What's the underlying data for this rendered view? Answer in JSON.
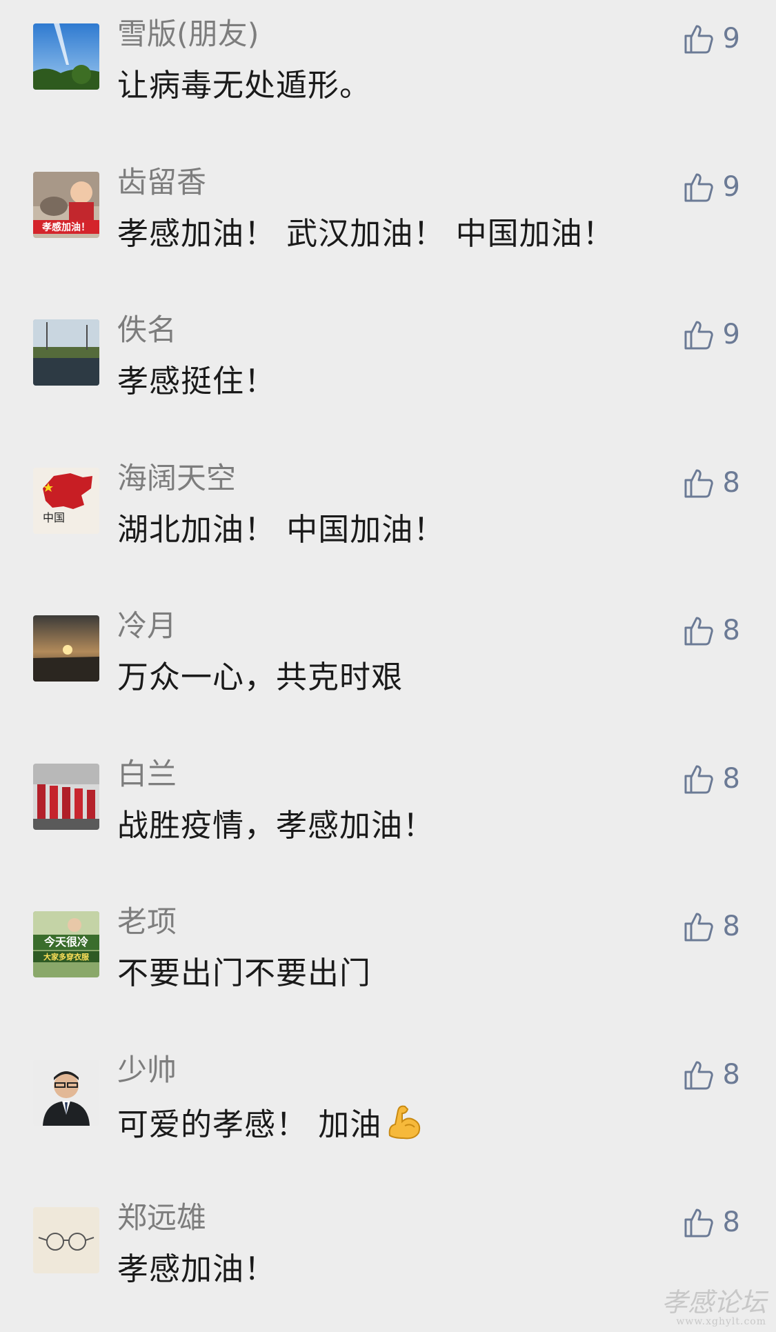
{
  "colors": {
    "background": "#ededed",
    "name": "#7d7d7d",
    "text": "#1a1a1a",
    "like": "#6b7a95"
  },
  "like_icon": "thumbs-up-icon",
  "comments": [
    {
      "name": "雪版(朋友)",
      "text": "让病毒无处遁形。",
      "likes": "9"
    },
    {
      "name": "齿留香",
      "text": "孝感加油！ 武汉加油！ 中国加油！",
      "likes": "9",
      "avatar_text": "孝感加油！"
    },
    {
      "name": "佚名",
      "text": "孝感挺住！",
      "likes": "9"
    },
    {
      "name": "海阔天空",
      "text": "湖北加油！ 中国加油！",
      "likes": "8",
      "avatar_text": "中国"
    },
    {
      "name": "冷月",
      "text": "万众一心，共克时艰",
      "likes": "8"
    },
    {
      "name": "白兰",
      "text": "战胜疫情，孝感加油！",
      "likes": "8"
    },
    {
      "name": "老项",
      "text": "不要出门不要出门",
      "likes": "8",
      "avatar_text": "今天很冷",
      "avatar_subtext": "大家多穿衣服"
    },
    {
      "name": "少帅",
      "text": "可爱的孝感！ 加油",
      "likes": "8",
      "emoji": "flexed-biceps-icon"
    },
    {
      "name": "郑远雄",
      "text": "孝感加油！",
      "likes": "8"
    }
  ],
  "watermark": {
    "text": "孝感论坛",
    "url": "www.xghylt.com"
  }
}
